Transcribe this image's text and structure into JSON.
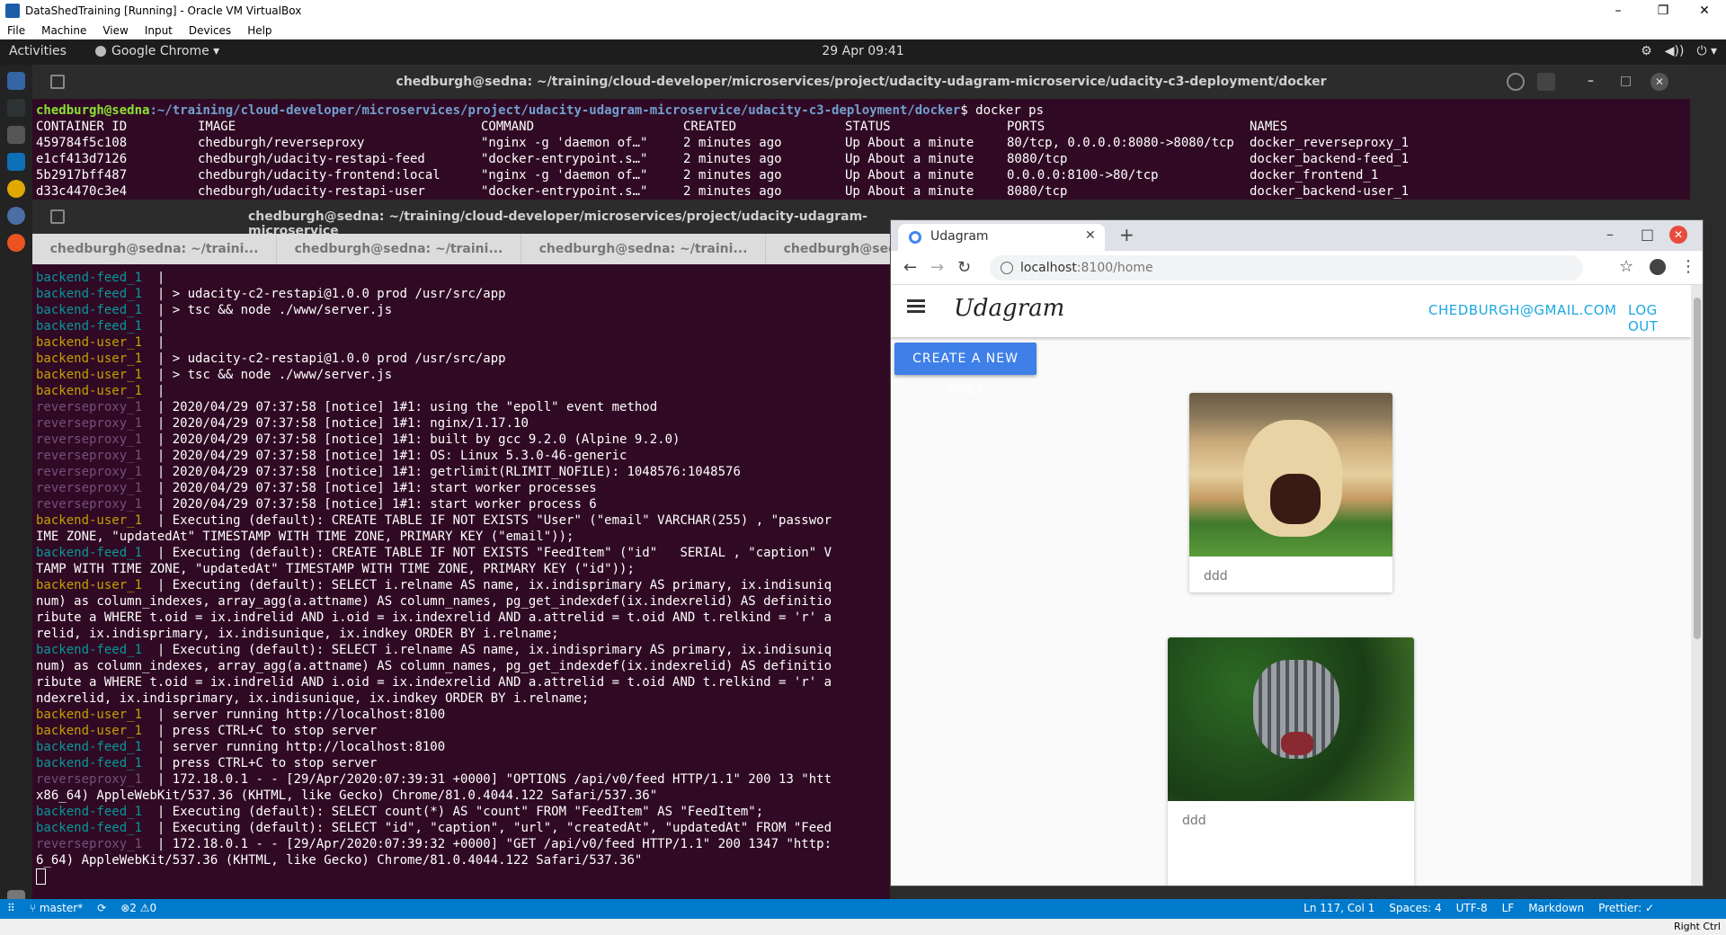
{
  "vbox": {
    "title": "DataShedTraining [Running] - Oracle VM VirtualBox",
    "menu": [
      "File",
      "Machine",
      "View",
      "Input",
      "Devices",
      "Help"
    ],
    "controls": [
      "–",
      "❐",
      "✕"
    ]
  },
  "topbar": {
    "activities": "Activities",
    "app": "Google Chrome ▾",
    "clock": "29 Apr  09:41",
    "tray": [
      "⚙",
      "◀))",
      "⏻ ▾"
    ]
  },
  "term1": {
    "title": "chedburgh@sedna: ~/training/cloud-developer/microservices/project/udacity-udagram-microservice/udacity-c3-deployment/docker",
    "prompt_user": "chedburgh@sedna",
    "prompt_path": ":~/training/cloud-developer/microservices/project/udacity-udagram-microservice/udacity-c3-deployment/docker",
    "prompt_cmd": "$ docker ps",
    "headers": [
      "CONTAINER ID",
      "IMAGE",
      "COMMAND",
      "CREATED",
      "STATUS",
      "PORTS",
      "NAMES"
    ],
    "rows": [
      [
        "459784f5c108",
        "chedburgh/reverseproxy",
        "\"nginx -g 'daemon of…\"",
        "2 minutes ago",
        "Up About a minute",
        "80/tcp, 0.0.0.0:8080->8080/tcp",
        "docker_reverseproxy_1"
      ],
      [
        "e1cf413d7126",
        "chedburgh/udacity-restapi-feed",
        "\"docker-entrypoint.s…\"",
        "2 minutes ago",
        "Up About a minute",
        "8080/tcp",
        "docker_backend-feed_1"
      ],
      [
        "5b2917bff487",
        "chedburgh/udacity-frontend:local",
        "\"nginx -g 'daemon of…\"",
        "2 minutes ago",
        "Up About a minute",
        "0.0.0.0:8100->80/tcp",
        "docker_frontend_1"
      ],
      [
        "d33c4470c3e4",
        "chedburgh/udacity-restapi-user",
        "\"docker-entrypoint.s…\"",
        "2 minutes ago",
        "Up About a minute",
        "8080/tcp",
        "docker_backend-user_1"
      ]
    ]
  },
  "term2": {
    "title": "chedburgh@sedna: ~/training/cloud-developer/microservices/project/udacity-udagram-microservice",
    "tabs": [
      "chedburgh@sedna: ~/traini...",
      "chedburgh@sedna: ~/traini...",
      "chedburgh@sedna: ~/traini...",
      "chedburgh@sedna: ~/traini..."
    ],
    "lines": [
      {
        "src": "backend-feed_1 ",
        "text": " |",
        "c": "grn"
      },
      {
        "src": "backend-feed_1 ",
        "text": " | > udacity-c2-restapi@1.0.0 prod /usr/src/app",
        "c": "grn"
      },
      {
        "src": "backend-feed_1 ",
        "text": " | > tsc && node ./www/server.js",
        "c": "grn"
      },
      {
        "src": "backend-feed_1 ",
        "text": " |",
        "c": "grn"
      },
      {
        "src": "backend-user_1 ",
        "text": " |",
        "c": "yel"
      },
      {
        "src": "backend-user_1 ",
        "text": " | > udacity-c2-restapi@1.0.0 prod /usr/src/app",
        "c": "yel"
      },
      {
        "src": "backend-user_1 ",
        "text": " | > tsc && node ./www/server.js",
        "c": "yel"
      },
      {
        "src": "backend-user_1 ",
        "text": " |",
        "c": "yel"
      },
      {
        "src": "reverseproxy_1 ",
        "text": " | 2020/04/29 07:37:58 [notice] 1#1: using the \"epoll\" event method",
        "c": "red"
      },
      {
        "src": "reverseproxy_1 ",
        "text": " | 2020/04/29 07:37:58 [notice] 1#1: nginx/1.17.10",
        "c": "red"
      },
      {
        "src": "reverseproxy_1 ",
        "text": " | 2020/04/29 07:37:58 [notice] 1#1: built by gcc 9.2.0 (Alpine 9.2.0)",
        "c": "red"
      },
      {
        "src": "reverseproxy_1 ",
        "text": " | 2020/04/29 07:37:58 [notice] 1#1: OS: Linux 5.3.0-46-generic",
        "c": "red"
      },
      {
        "src": "reverseproxy_1 ",
        "text": " | 2020/04/29 07:37:58 [notice] 1#1: getrlimit(RLIMIT_NOFILE): 1048576:1048576",
        "c": "red"
      },
      {
        "src": "reverseproxy_1 ",
        "text": " | 2020/04/29 07:37:58 [notice] 1#1: start worker processes",
        "c": "red"
      },
      {
        "src": "reverseproxy_1 ",
        "text": " | 2020/04/29 07:37:58 [notice] 1#1: start worker process 6",
        "c": "red"
      },
      {
        "src": "backend-user_1 ",
        "text": " | Executing (default): CREATE TABLE IF NOT EXISTS \"User\" (\"email\" VARCHAR(255) , \"passwor",
        "c": "yel"
      },
      {
        "src": "",
        "text": "IME ZONE, \"updatedAt\" TIMESTAMP WITH TIME ZONE, PRIMARY KEY (\"email\"));",
        "c": "none"
      },
      {
        "src": "backend-feed_1 ",
        "text": " | Executing (default): CREATE TABLE IF NOT EXISTS \"FeedItem\" (\"id\"   SERIAL , \"caption\" V",
        "c": "grn"
      },
      {
        "src": "",
        "text": "TAMP WITH TIME ZONE, \"updatedAt\" TIMESTAMP WITH TIME ZONE, PRIMARY KEY (\"id\"));",
        "c": "none"
      },
      {
        "src": "backend-user_1 ",
        "text": " | Executing (default): SELECT i.relname AS name, ix.indisprimary AS primary, ix.indisuniq",
        "c": "yel"
      },
      {
        "src": "",
        "text": "num) as column_indexes, array_agg(a.attname) AS column_names, pg_get_indexdef(ix.indexrelid) AS definitio",
        "c": "none"
      },
      {
        "src": "",
        "text": "ribute a WHERE t.oid = ix.indrelid AND i.oid = ix.indexrelid AND a.attrelid = t.oid AND t.relkind = 'r' a",
        "c": "none"
      },
      {
        "src": "",
        "text": "relid, ix.indisprimary, ix.indisunique, ix.indkey ORDER BY i.relname;",
        "c": "none"
      },
      {
        "src": "backend-feed_1 ",
        "text": " | Executing (default): SELECT i.relname AS name, ix.indisprimary AS primary, ix.indisuniq",
        "c": "grn"
      },
      {
        "src": "",
        "text": "num) as column_indexes, array_agg(a.attname) AS column_names, pg_get_indexdef(ix.indexrelid) AS definitio",
        "c": "none"
      },
      {
        "src": "",
        "text": "ribute a WHERE t.oid = ix.indrelid AND i.oid = ix.indexrelid AND a.attrelid = t.oid AND t.relkind = 'r' a",
        "c": "none"
      },
      {
        "src": "",
        "text": "ndexrelid, ix.indisprimary, ix.indisunique, ix.indkey ORDER BY i.relname;",
        "c": "none"
      },
      {
        "src": "backend-user_1 ",
        "text": " | server running http://localhost:8100",
        "c": "yel"
      },
      {
        "src": "backend-user_1 ",
        "text": " | press CTRL+C to stop server",
        "c": "yel"
      },
      {
        "src": "backend-feed_1 ",
        "text": " | server running http://localhost:8100",
        "c": "grn"
      },
      {
        "src": "backend-feed_1 ",
        "text": " | press CTRL+C to stop server",
        "c": "grn"
      },
      {
        "src": "reverseproxy_1 ",
        "text": " | 172.18.0.1 - - [29/Apr/2020:07:39:31 +0000] \"OPTIONS /api/v0/feed HTTP/1.1\" 200 13 \"htt",
        "c": "red"
      },
      {
        "src": "",
        "text": "x86_64) AppleWebKit/537.36 (KHTML, like Gecko) Chrome/81.0.4044.122 Safari/537.36\"",
        "c": "none"
      },
      {
        "src": "backend-feed_1 ",
        "text": " | Executing (default): SELECT count(*) AS \"count\" FROM \"FeedItem\" AS \"FeedItem\";",
        "c": "grn"
      },
      {
        "src": "backend-feed_1 ",
        "text": " | Executing (default): SELECT \"id\", \"caption\", \"url\", \"createdAt\", \"updatedAt\" FROM \"Feed",
        "c": "grn"
      },
      {
        "src": "reverseproxy_1 ",
        "text": " | 172.18.0.1 - - [29/Apr/2020:07:39:32 +0000] \"GET /api/v0/feed HTTP/1.1\" 200 1347 \"http:",
        "c": "red"
      },
      {
        "src": "",
        "text": "6_64) AppleWebKit/537.36 (KHTML, like Gecko) Chrome/81.0.4044.122 Safari/537.36\"",
        "c": "none"
      }
    ]
  },
  "browser": {
    "tab_title": "Udagram",
    "url_host": "localhost",
    "url_path": ":8100/home",
    "brand": "Udagram",
    "user_email": "CHEDBURGH@GMAIL.COM",
    "logout": "LOG OUT",
    "create_post": "CREATE A NEW POST",
    "posts": [
      {
        "caption": "ddd",
        "image": "dog"
      },
      {
        "caption": "ddd",
        "image": "cat"
      }
    ]
  },
  "statusbar": {
    "branch": "master*",
    "problems": "⊗2 ⚠0",
    "position": "Ln 117, Col 1",
    "spaces": "Spaces: 4",
    "encoding": "UTF-8",
    "eol": "LF",
    "language": "Markdown",
    "prettier": "Prettier: ✓",
    "host_key": "Right Ctrl"
  },
  "colors": {
    "terminal_bg": "#300a24",
    "accent_blue": "#3f7fe8",
    "link_cyan": "#1ca8e0",
    "status_blue": "#007acc"
  }
}
